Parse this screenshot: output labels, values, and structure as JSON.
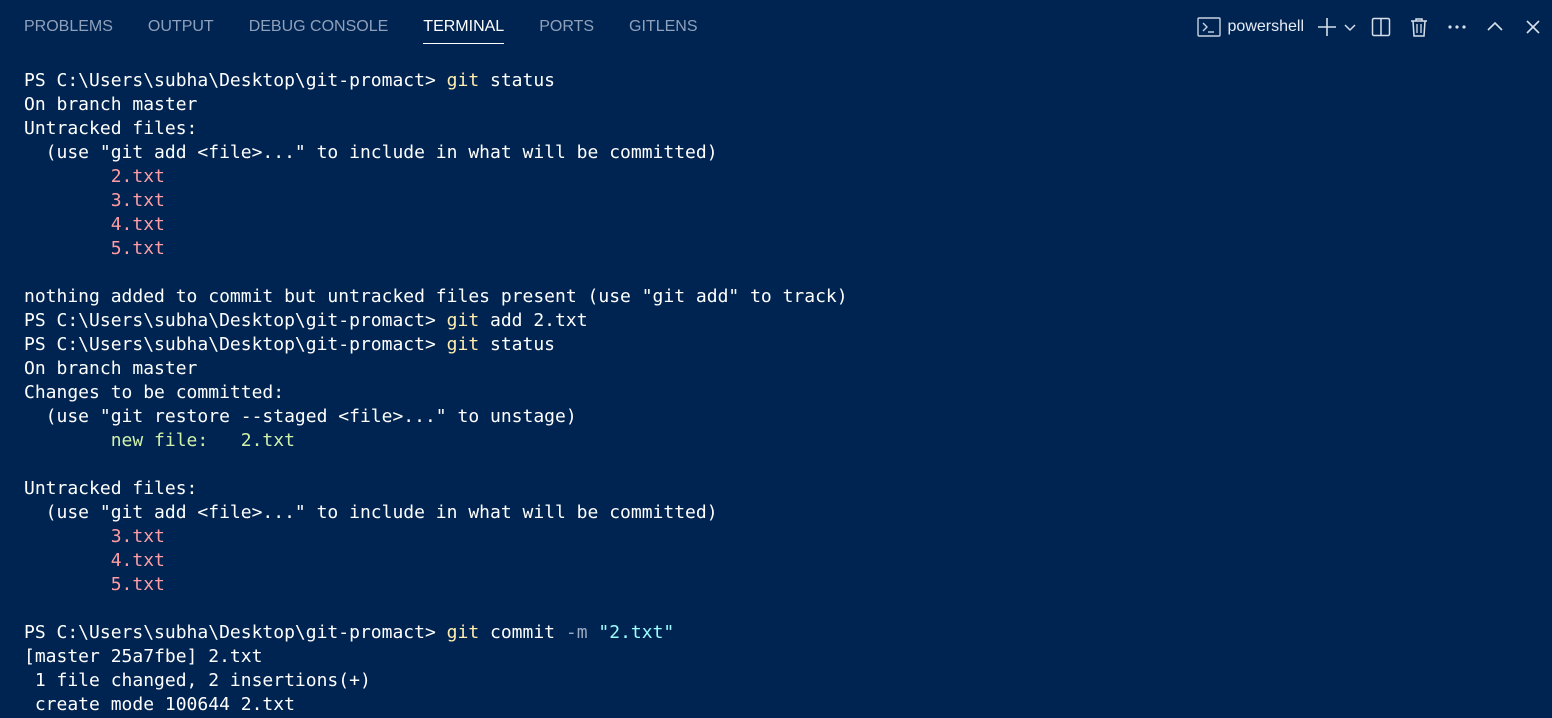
{
  "panel": {
    "tabs": [
      {
        "label": "PROBLEMS",
        "active": false
      },
      {
        "label": "OUTPUT",
        "active": false
      },
      {
        "label": "DEBUG CONSOLE",
        "active": false
      },
      {
        "label": "TERMINAL",
        "active": true
      },
      {
        "label": "PORTS",
        "active": false
      },
      {
        "label": "GITLENS",
        "active": false
      }
    ],
    "terminal_name": "powershell",
    "icons": {
      "terminal": "terminal-icon",
      "new": "plus-icon",
      "dropdown": "chevron-down-icon",
      "split": "split-icon",
      "kill": "trash-icon",
      "more": "ellipsis-icon",
      "maximize": "chevron-up-icon",
      "close": "close-icon"
    }
  },
  "colors": {
    "background": "#002451",
    "command": "#ffeead",
    "untracked": "#ff9da4",
    "staged": "#d1f1a9",
    "string": "#99ffff"
  },
  "terminal": {
    "lines": [
      [
        {
          "t": "PS C:\\Users\\subha\\Desktop\\git-promact> "
        },
        {
          "t": "git",
          "c": "cmd"
        },
        {
          "t": " status"
        }
      ],
      [
        {
          "t": "On branch master"
        }
      ],
      [
        {
          "t": "Untracked files:"
        }
      ],
      [
        {
          "t": "  (use \"git add <file>...\" to include in what will be committed)"
        }
      ],
      [
        {
          "t": "        "
        },
        {
          "t": "2.txt",
          "c": "red"
        }
      ],
      [
        {
          "t": "        "
        },
        {
          "t": "3.txt",
          "c": "red"
        }
      ],
      [
        {
          "t": "        "
        },
        {
          "t": "4.txt",
          "c": "red"
        }
      ],
      [
        {
          "t": "        "
        },
        {
          "t": "5.txt",
          "c": "red"
        }
      ],
      [
        {
          "t": ""
        }
      ],
      [
        {
          "t": "nothing added to commit but untracked files present (use \"git add\" to track)"
        }
      ],
      [
        {
          "t": "PS C:\\Users\\subha\\Desktop\\git-promact> "
        },
        {
          "t": "git",
          "c": "cmd"
        },
        {
          "t": " add 2.txt"
        }
      ],
      [
        {
          "t": "PS C:\\Users\\subha\\Desktop\\git-promact> "
        },
        {
          "t": "git",
          "c": "cmd"
        },
        {
          "t": " status"
        }
      ],
      [
        {
          "t": "On branch master"
        }
      ],
      [
        {
          "t": "Changes to be committed:"
        }
      ],
      [
        {
          "t": "  (use \"git restore --staged <file>...\" to unstage)"
        }
      ],
      [
        {
          "t": "        "
        },
        {
          "t": "new file:   2.txt",
          "c": "green"
        }
      ],
      [
        {
          "t": ""
        }
      ],
      [
        {
          "t": "Untracked files:"
        }
      ],
      [
        {
          "t": "  (use \"git add <file>...\" to include in what will be committed)"
        }
      ],
      [
        {
          "t": "        "
        },
        {
          "t": "3.txt",
          "c": "red"
        }
      ],
      [
        {
          "t": "        "
        },
        {
          "t": "4.txt",
          "c": "red"
        }
      ],
      [
        {
          "t": "        "
        },
        {
          "t": "5.txt",
          "c": "red"
        }
      ],
      [
        {
          "t": ""
        }
      ],
      [
        {
          "t": "PS C:\\Users\\subha\\Desktop\\git-promact> "
        },
        {
          "t": "git",
          "c": "cmd"
        },
        {
          "t": " commit "
        },
        {
          "t": "-m",
          "c": "flag"
        },
        {
          "t": " "
        },
        {
          "t": "\"2.txt\"",
          "c": "str"
        }
      ],
      [
        {
          "t": "[master 25a7fbe] 2.txt"
        }
      ],
      [
        {
          "t": " 1 file changed, 2 insertions(+)"
        }
      ],
      [
        {
          "t": " create mode 100644 2.txt"
        }
      ]
    ]
  }
}
